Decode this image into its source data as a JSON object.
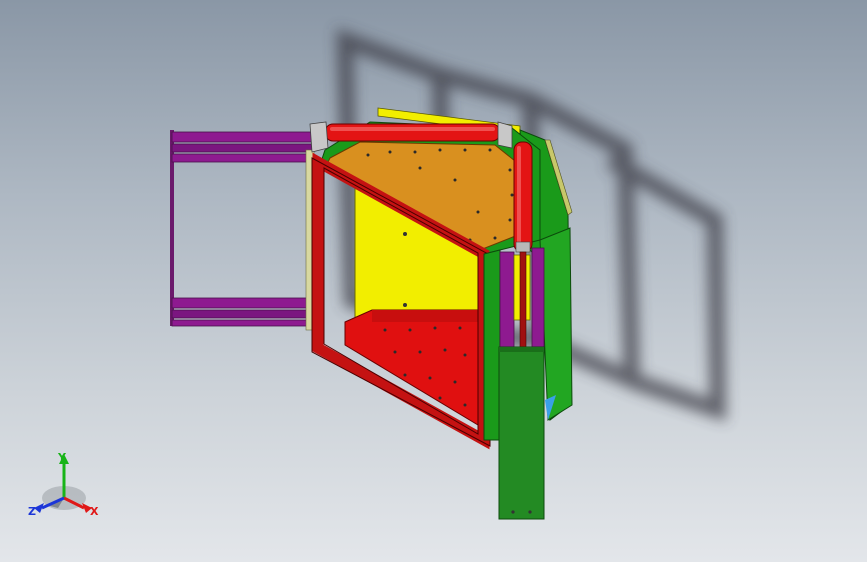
{
  "viewport": {
    "background_top": "#8a97a6",
    "background_bottom": "#e3e6ea"
  },
  "model": {
    "colors": {
      "frame_green": "#1a9a1a",
      "top_plate": "#d9901f",
      "back_panel": "#f2ee00",
      "floor_red": "#e01010",
      "frame_red": "#c41212",
      "rail_purple": "#8e1a90",
      "roller_red": "#e31414",
      "post_green": "#238a23",
      "shadow": "#3c3c46"
    }
  },
  "triad": {
    "x_label": "X",
    "y_label": "Y",
    "z_label": "Z",
    "x_color": "#e01818",
    "y_color": "#18b418",
    "z_color": "#1c36d8"
  }
}
